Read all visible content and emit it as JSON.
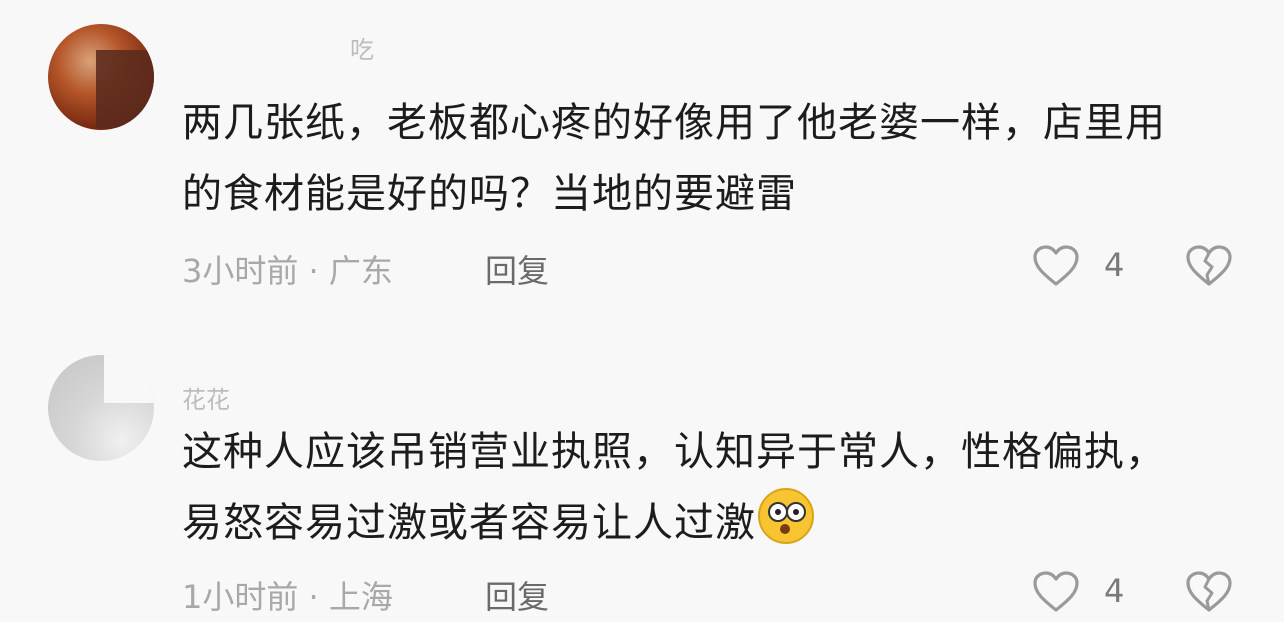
{
  "comments": [
    {
      "username": "吃",
      "text": "两几张纸，老板都心疼的好像用了他老婆一样，店里用的食材能是好的吗？当地的要避雷",
      "time_location": "3小时前 · 广东",
      "reply_label": "回复",
      "likes": "4"
    },
    {
      "username": "花花",
      "text": "这种人应该吊销营业执照，认知异于常人，性格偏执，易怒容易过激或者容易让人过激",
      "emoji": "astonished-face",
      "time_location": "1小时前 · 上海",
      "reply_label": "回复",
      "likes": "4"
    }
  ],
  "icons": {
    "like": "heart-outline-icon",
    "dislike": "broken-heart-outline-icon"
  },
  "colors": {
    "background": "#f8f8f8",
    "text": "#1c1c1c",
    "meta": "#a8a8a8",
    "reply": "#6a6a6a"
  }
}
